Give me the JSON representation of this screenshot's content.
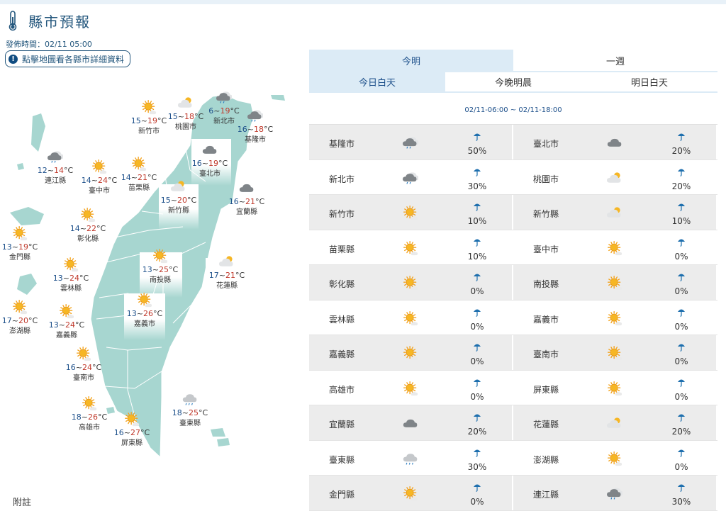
{
  "page": {
    "title": "縣市預報",
    "issue_time": "發佈時間：02/11 05:00",
    "map_button": "點擊地圖看各縣市詳細資料",
    "footer_note": "附註"
  },
  "tabs": {
    "top": [
      {
        "label": "今明",
        "active": true
      },
      {
        "label": "一週",
        "active": false
      }
    ],
    "sub": [
      {
        "label": "今日白天",
        "active": true
      },
      {
        "label": "今晚明晨",
        "active": false
      },
      {
        "label": "明日白天",
        "active": false
      }
    ]
  },
  "time_range": "02/11-06:00 ~ 02/11-18:00",
  "temp_unit": "°C",
  "temp_separator": "~",
  "map_cities": [
    {
      "name": "新竹市",
      "min": "15",
      "max": "19",
      "icon": "sunny-icon"
    },
    {
      "name": "桃園市",
      "min": "15",
      "max": "18",
      "icon": "partly-cloudy-icon"
    },
    {
      "name": "新北市",
      "min": "6",
      "max": "19",
      "icon": "cloudy-rain-icon"
    },
    {
      "name": "基隆市",
      "min": "16",
      "max": "18",
      "icon": "cloudy-rain-icon"
    },
    {
      "name": "連江縣",
      "min": "12",
      "max": "14",
      "icon": "cloudy-rain-icon"
    },
    {
      "name": "臺中市",
      "min": "14",
      "max": "24",
      "icon": "sunny-icon"
    },
    {
      "name": "苗栗縣",
      "min": "14",
      "max": "21",
      "icon": "sunny-icon"
    },
    {
      "name": "臺北市",
      "min": "16",
      "max": "19",
      "icon": "cloudy-icon"
    },
    {
      "name": "新竹縣",
      "min": "15",
      "max": "20",
      "icon": "partly-cloudy-icon"
    },
    {
      "name": "宜蘭縣",
      "min": "16",
      "max": "21",
      "icon": "cloudy-icon"
    },
    {
      "name": "彰化縣",
      "min": "14",
      "max": "22",
      "icon": "sunny-icon"
    },
    {
      "name": "金門縣",
      "min": "13",
      "max": "19",
      "icon": "sunny-icon"
    },
    {
      "name": "南投縣",
      "min": "13",
      "max": "25",
      "icon": "sunny-icon"
    },
    {
      "name": "雲林縣",
      "min": "13",
      "max": "24",
      "icon": "sunny-icon"
    },
    {
      "name": "花蓮縣",
      "min": "17",
      "max": "21",
      "icon": "partly-cloudy-icon"
    },
    {
      "name": "澎湖縣",
      "min": "17",
      "max": "20",
      "icon": "sunny-icon"
    },
    {
      "name": "嘉義縣",
      "min": "13",
      "max": "24",
      "icon": "sunny-icon"
    },
    {
      "name": "嘉義市",
      "min": "13",
      "max": "26",
      "icon": "sunny-icon"
    },
    {
      "name": "臺南市",
      "min": "16",
      "max": "24",
      "icon": "sunny-icon"
    },
    {
      "name": "高雄市",
      "min": "18",
      "max": "26",
      "icon": "sunny-icon"
    },
    {
      "name": "屏東縣",
      "min": "16",
      "max": "27",
      "icon": "sunny-icon"
    },
    {
      "name": "臺東縣",
      "min": "18",
      "max": "25",
      "icon": "cloudy-drizzle-icon"
    }
  ],
  "table": [
    {
      "name": "基隆市",
      "icon": "cloudy-rain-icon",
      "rain": "50%"
    },
    {
      "name": "臺北市",
      "icon": "cloudy-icon",
      "rain": "20%"
    },
    {
      "name": "新北市",
      "icon": "cloudy-rain-icon",
      "rain": "30%"
    },
    {
      "name": "桃園市",
      "icon": "partly-cloudy-icon",
      "rain": "20%"
    },
    {
      "name": "新竹市",
      "icon": "sunny-icon",
      "rain": "10%"
    },
    {
      "name": "新竹縣",
      "icon": "partly-cloudy-icon",
      "rain": "10%"
    },
    {
      "name": "苗栗縣",
      "icon": "sunny-icon",
      "rain": "10%"
    },
    {
      "name": "臺中市",
      "icon": "sunny-icon",
      "rain": "0%"
    },
    {
      "name": "彰化縣",
      "icon": "sunny-icon",
      "rain": "0%"
    },
    {
      "name": "南投縣",
      "icon": "sunny-icon",
      "rain": "0%"
    },
    {
      "name": "雲林縣",
      "icon": "sunny-icon",
      "rain": "0%"
    },
    {
      "name": "嘉義市",
      "icon": "sunny-icon",
      "rain": "0%"
    },
    {
      "name": "嘉義縣",
      "icon": "sunny-icon",
      "rain": "0%"
    },
    {
      "name": "臺南市",
      "icon": "sunny-icon",
      "rain": "0%"
    },
    {
      "name": "高雄市",
      "icon": "sunny-icon",
      "rain": "0%"
    },
    {
      "name": "屏東縣",
      "icon": "sunny-icon",
      "rain": "0%"
    },
    {
      "name": "宜蘭縣",
      "icon": "cloudy-icon",
      "rain": "20%"
    },
    {
      "name": "花蓮縣",
      "icon": "partly-cloudy-icon",
      "rain": "20%"
    },
    {
      "name": "臺東縣",
      "icon": "cloudy-drizzle-icon",
      "rain": "30%"
    },
    {
      "name": "澎湖縣",
      "icon": "sunny-icon",
      "rain": "0%"
    },
    {
      "name": "金門縣",
      "icon": "sunny-icon",
      "rain": "0%"
    },
    {
      "name": "連江縣",
      "icon": "cloudy-rain-icon",
      "rain": "30%"
    }
  ],
  "colors": {
    "accent": "#24577d",
    "land": "#a7d6d0",
    "tab_active": "#dcebf6",
    "temp_min": "#1c4f8a",
    "temp_max": "#c0392b",
    "row_shade": "#ececec"
  }
}
